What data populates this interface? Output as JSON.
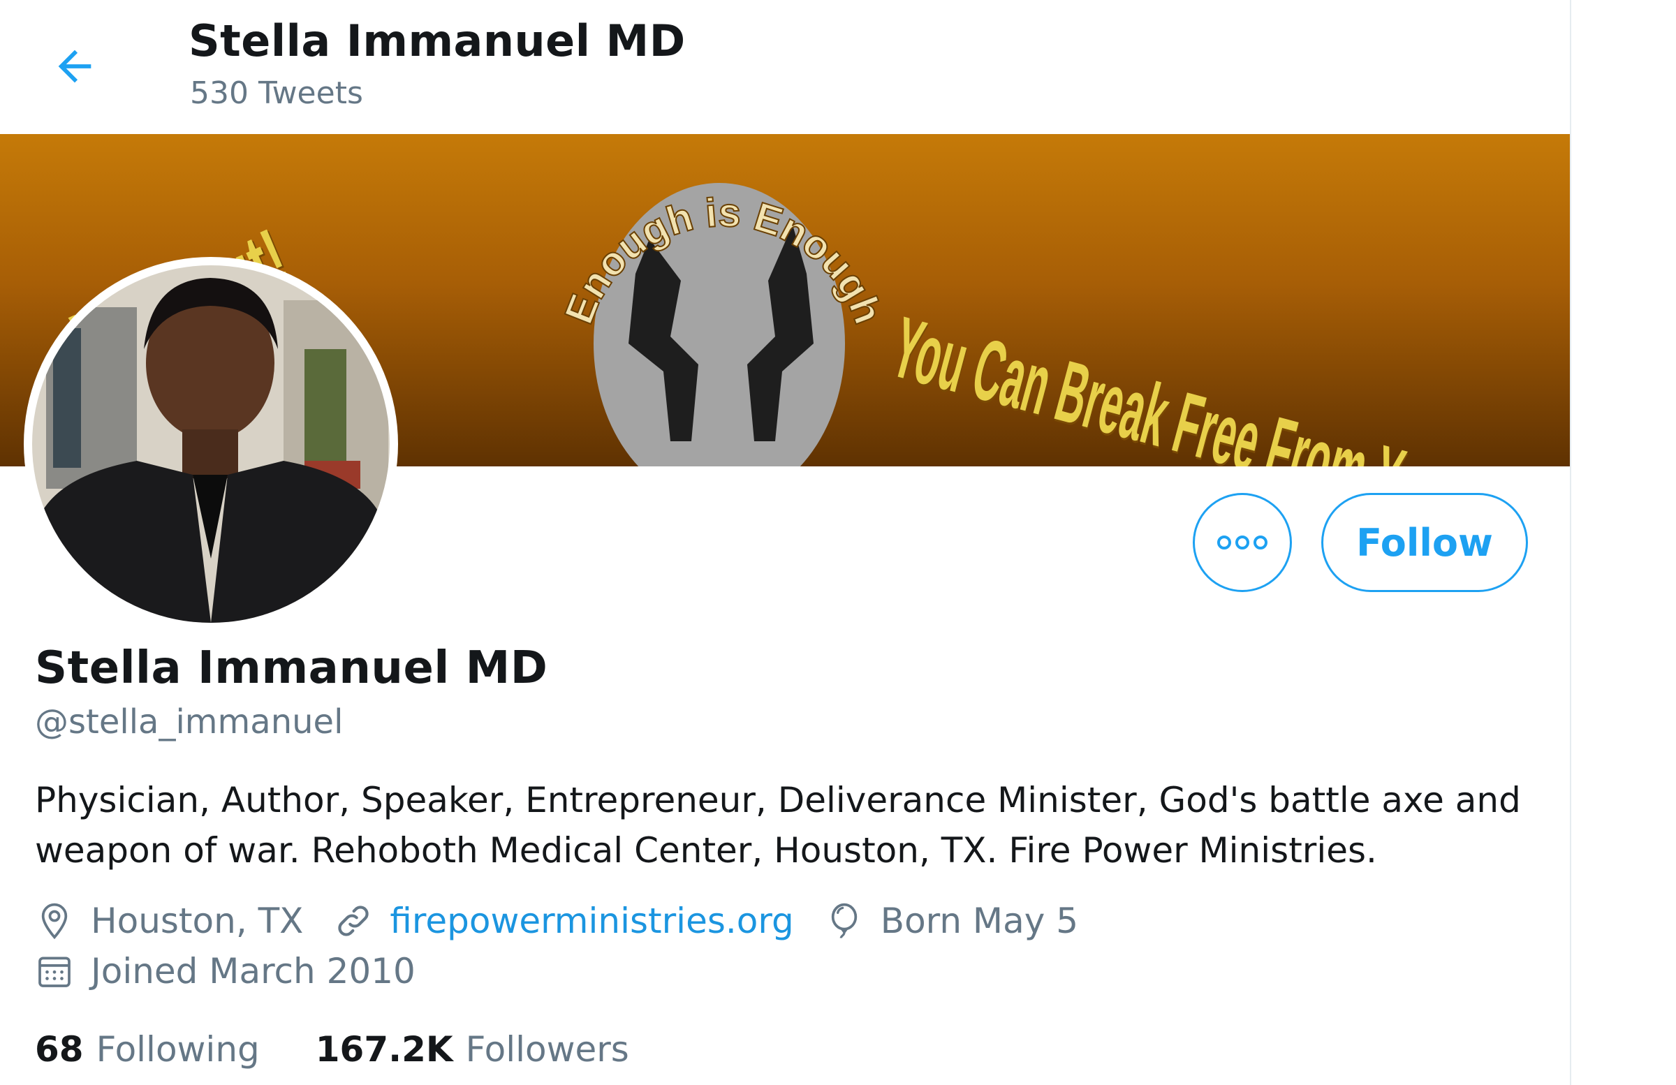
{
  "header": {
    "title": "Stella Immanuel MD",
    "tweet_count": "530 Tweets",
    "back_icon": "arrow-left-icon"
  },
  "banner": {
    "text_left": "... Way Out!",
    "text_emblem": "Enough is Enough",
    "text_right": "You Can Break Free From Your Past!"
  },
  "profile": {
    "display_name": "Stella Immanuel MD",
    "handle": "@stella_immanuel",
    "bio": "Physician, Author, Speaker, Entrepreneur, Deliverance Minister, God's battle axe and weapon of war. Rehoboth Medical Center, Houston, TX. Fire Power Ministries.",
    "location": "Houston, TX",
    "website": "firepowerministries.org",
    "birthday": "Born May 5",
    "joined": "Joined March 2010"
  },
  "actions": {
    "more_icon": "more-dots-icon",
    "follow_label": "Follow"
  },
  "stats": {
    "following_count": "68",
    "following_label": "Following",
    "followers_count": "167.2K",
    "followers_label": "Followers"
  },
  "colors": {
    "accent": "#1da1f2",
    "link": "#1b95e0",
    "muted": "#657786",
    "text": "#14171a"
  }
}
